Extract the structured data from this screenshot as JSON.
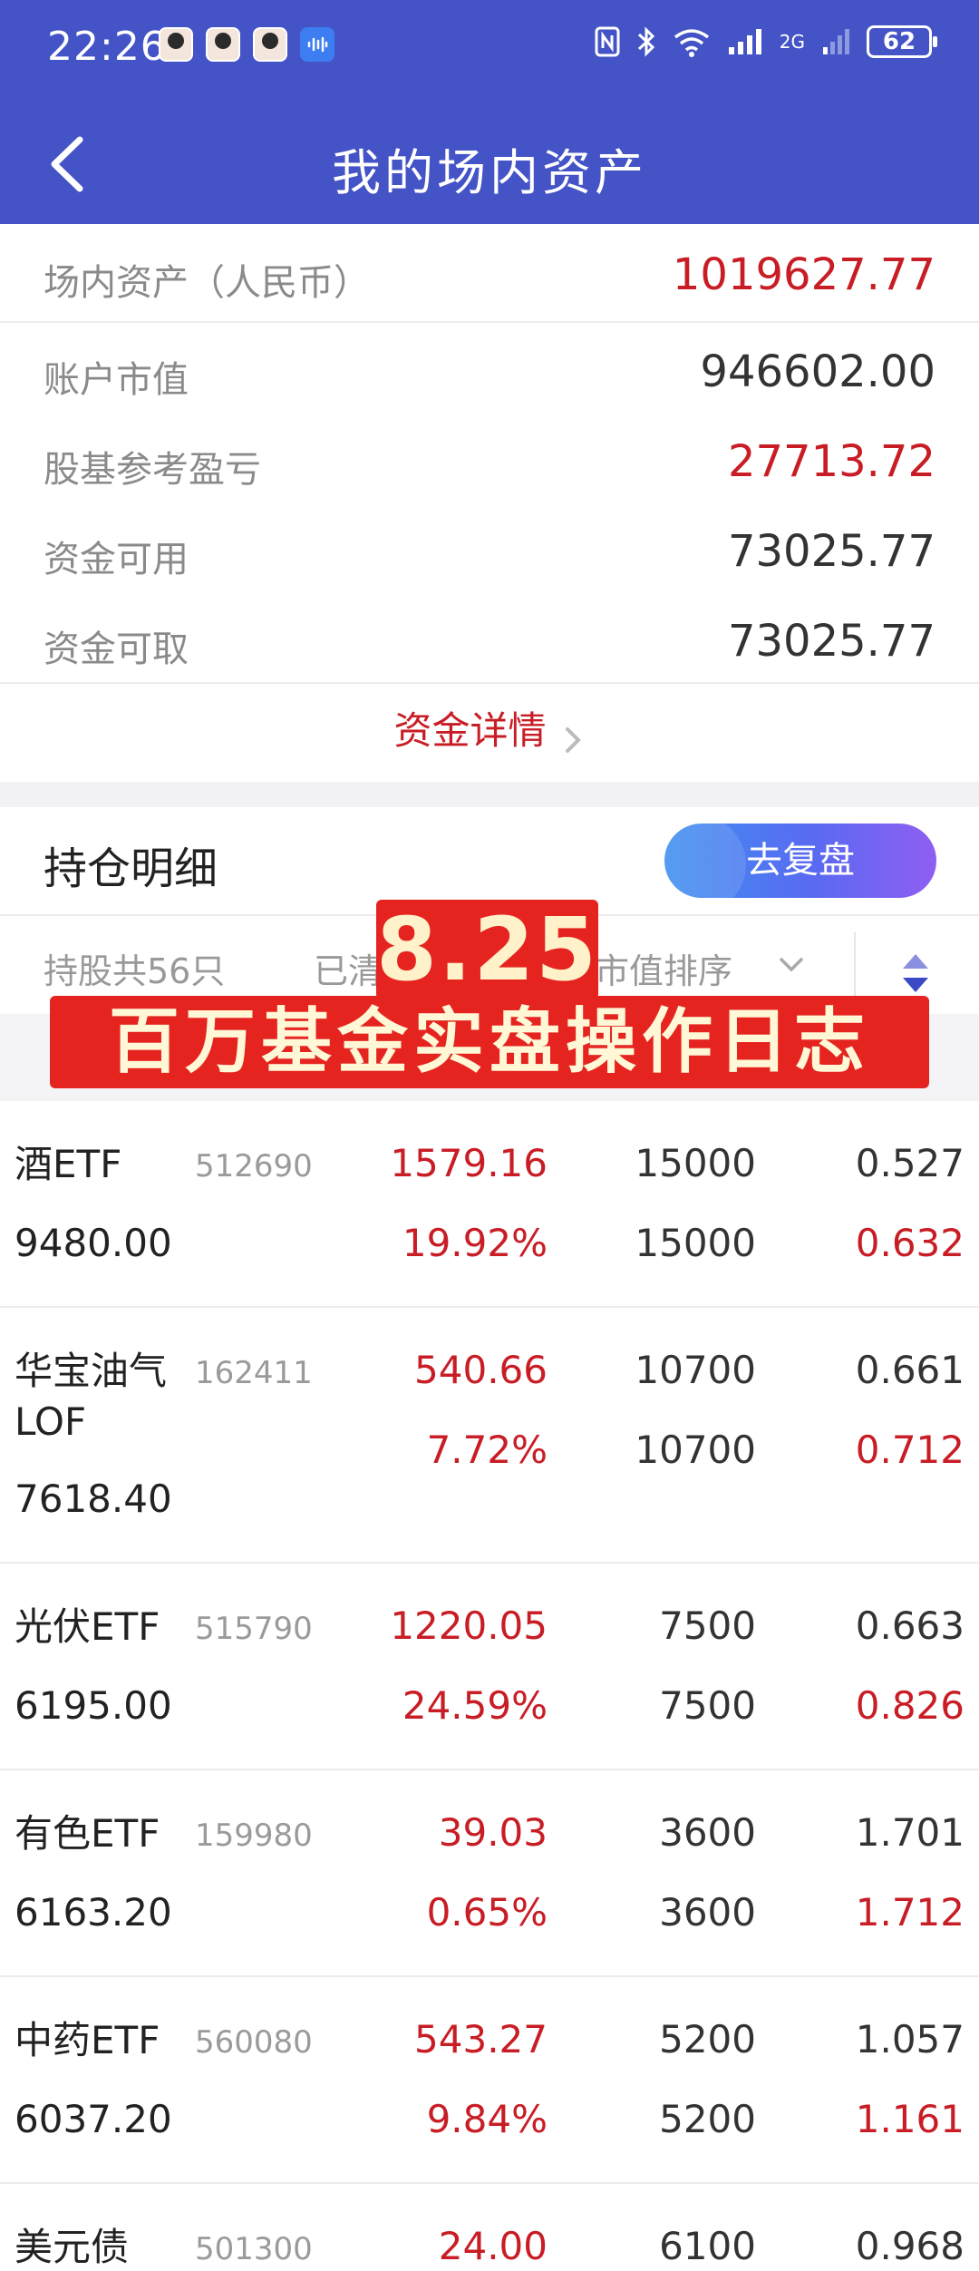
{
  "status_bar": {
    "time": "22:26",
    "battery": "62",
    "signal_label": "2G"
  },
  "nav": {
    "title": "我的场内资产"
  },
  "summary": {
    "total_label": "场内资产（人民币）",
    "total_value": "1019627.77",
    "market_value_label": "账户市值",
    "market_value": "946602.00",
    "pnl_label": "股基参考盈亏",
    "pnl_value": "27713.72",
    "available_label": "资金可用",
    "available_value": "73025.77",
    "withdrawable_label": "资金可取",
    "withdrawable_value": "73025.77",
    "detail_link": "资金详情"
  },
  "holdings_section": {
    "title": "持仓明细",
    "review_button": "去复盘",
    "count_label": "持股共56只",
    "cleared_label": "已清",
    "sort_label": "市值排序"
  },
  "overlay": {
    "date": "8.25",
    "caption": "百万基金实盘操作日志"
  },
  "holdings": [
    {
      "name": "酒ETF",
      "code": "512690",
      "market_value": "9480.00",
      "pnl": "1579.16",
      "pnl_pct": "19.92%",
      "qty": "15000",
      "available": "15000",
      "price": "0.527",
      "cost": "0.632"
    },
    {
      "name": "华宝油气LOF",
      "name_line1": "华宝油气",
      "name_line2": "LOF",
      "code": "162411",
      "market_value": "7618.40",
      "pnl": "540.66",
      "pnl_pct": "7.72%",
      "qty": "10700",
      "available": "10700",
      "price": "0.661",
      "cost": "0.712"
    },
    {
      "name": "光伏ETF",
      "code": "515790",
      "market_value": "6195.00",
      "pnl": "1220.05",
      "pnl_pct": "24.59%",
      "qty": "7500",
      "available": "7500",
      "price": "0.663",
      "cost": "0.826"
    },
    {
      "name": "有色ETF",
      "code": "159980",
      "market_value": "6163.20",
      "pnl": "39.03",
      "pnl_pct": "0.65%",
      "qty": "3600",
      "available": "3600",
      "price": "1.701",
      "cost": "1.712"
    },
    {
      "name": "中药ETF",
      "code": "560080",
      "market_value": "6037.20",
      "pnl": "543.27",
      "pnl_pct": "9.84%",
      "qty": "5200",
      "available": "5200",
      "price": "1.057",
      "cost": "1.161"
    },
    {
      "name": "美元债",
      "code": "501300",
      "pnl": "24.00",
      "qty": "6100",
      "price": "0.968"
    }
  ],
  "colors": {
    "brand_blue": "#4453c6",
    "loss_red": "#c81d25",
    "overlay_red": "#e52420"
  }
}
